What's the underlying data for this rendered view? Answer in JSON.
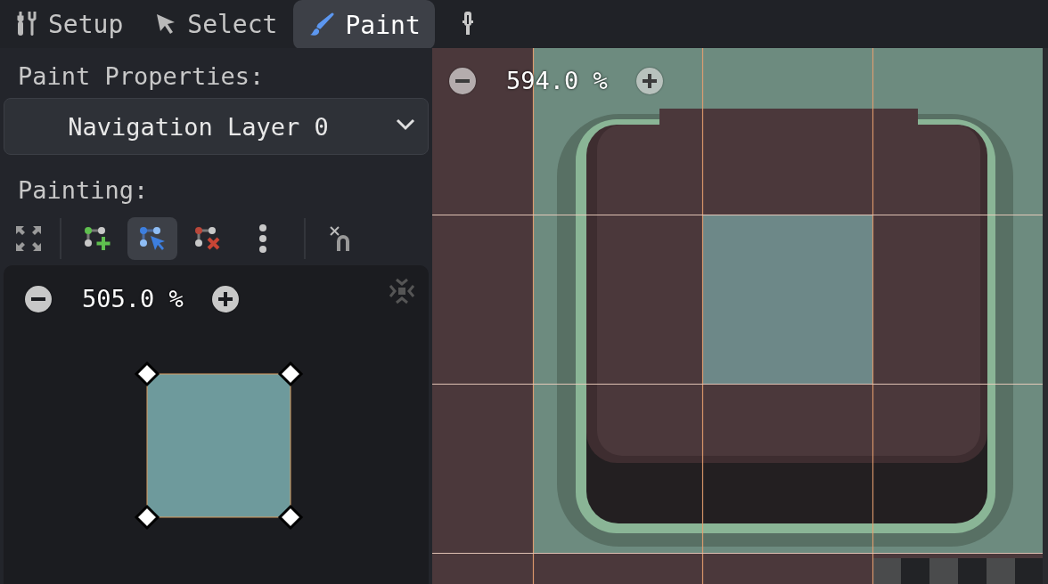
{
  "tabs": [
    {
      "label": "Setup",
      "kind": "tools",
      "selected": false
    },
    {
      "label": "Select",
      "kind": "cursor",
      "selected": false
    },
    {
      "label": "Paint",
      "kind": "brush",
      "selected": true
    },
    {
      "kind": "picker",
      "selected": false
    }
  ],
  "paint_panel": {
    "title": "Paint Properties:",
    "dropdown": {
      "value": "Navigation Layer 0"
    },
    "painting_label": "Painting:",
    "tool_groups": [
      {
        "tools": [
          {
            "kind": "expand",
            "selected": false
          }
        ]
      },
      {
        "tools": [
          {
            "kind": "add-point",
            "selected": false
          },
          {
            "kind": "select-point",
            "selected": true
          },
          {
            "kind": "remove-point",
            "selected": false
          },
          {
            "kind": "more",
            "selected": false
          }
        ]
      },
      {
        "tools": [
          {
            "kind": "clear",
            "selected": false
          }
        ]
      }
    ],
    "preview": {
      "zoom": "505.0 %"
    }
  },
  "canvas": {
    "zoom": "594.0 %"
  }
}
